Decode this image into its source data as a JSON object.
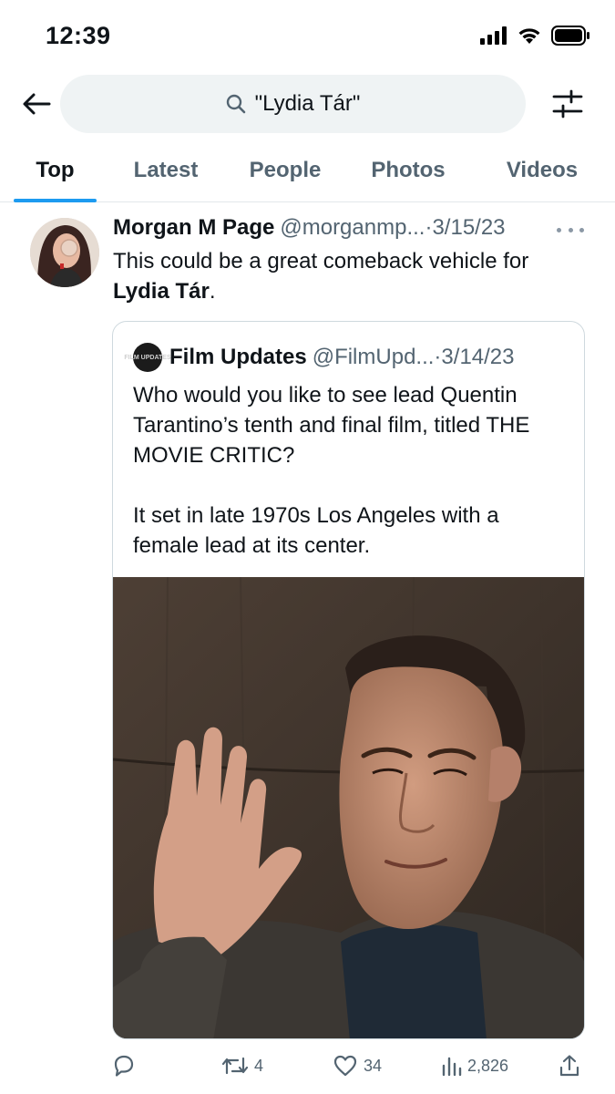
{
  "status_bar": {
    "time": "12:39"
  },
  "search": {
    "query": "\"Lydia Tár\""
  },
  "tabs": [
    {
      "label": "Top",
      "active": true
    },
    {
      "label": "Latest",
      "active": false
    },
    {
      "label": "People",
      "active": false
    },
    {
      "label": "Photos",
      "active": false
    },
    {
      "label": "Videos",
      "active": false
    }
  ],
  "tweet": {
    "display_name": "Morgan M Page",
    "handle": "@morganmp...",
    "separator": "·",
    "date": "3/15/23",
    "text_before": "This could be a great comeback vehicle for ",
    "text_bold": "Lydia Tár",
    "text_after": ".",
    "quote": {
      "avatar_text": "FILM UPDATES",
      "display_name": "Film Updates",
      "handle": "@FilmUpd...",
      "separator": "·",
      "date": "3/14/23",
      "text": "Who would you like to see lead Quentin Tarantino’s tenth and final film, titled THE MOVIE CRITIC?\n\nIt set in late 1970s Los Angeles with a female lead at its center."
    },
    "actions": {
      "reply": "",
      "retweets": "4",
      "likes": "34",
      "views": "2,826",
      "share": ""
    }
  },
  "icons": [
    "back-arrow-icon",
    "search-icon",
    "filter-icon",
    "more-icon",
    "reply-icon",
    "retweet-icon",
    "like-icon",
    "views-icon",
    "share-icon"
  ],
  "colors": {
    "accent": "#1d9bf0",
    "secondary_text": "#536471",
    "search_bg": "#eff3f4",
    "border": "#cfd9de"
  }
}
